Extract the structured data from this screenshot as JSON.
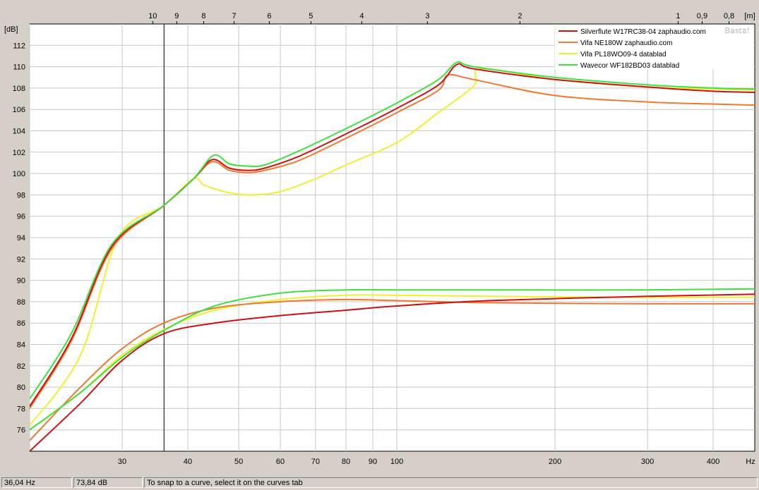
{
  "chart_data": {
    "type": "line",
    "x_axis": {
      "label": "Hz",
      "scale": "log",
      "range": [
        20,
        480
      ],
      "ticks": [
        30,
        40,
        50,
        60,
        70,
        80,
        90,
        100,
        200,
        300,
        400
      ]
    },
    "top_axis": {
      "label": "[m]",
      "ticks": [
        "10",
        "9",
        "8",
        "7",
        "6",
        "5",
        "4",
        "3",
        "2",
        "1",
        "0,9",
        "0,8"
      ]
    },
    "y_axis": {
      "label": "[dB]",
      "range": [
        74,
        114
      ],
      "ticks": [
        76,
        78,
        80,
        82,
        84,
        86,
        88,
        90,
        92,
        94,
        96,
        98,
        100,
        102,
        104,
        106,
        108,
        110,
        112
      ]
    },
    "grid": true,
    "legend_position": "top-right",
    "watermark": "Basta!",
    "cursor_x": 36.04,
    "series": [
      {
        "name": "Silverflute W17RC38-04 zaphaudio.com",
        "color": "#d01010",
        "upper": [
          [
            20,
            78.2
          ],
          [
            24,
            84.5
          ],
          [
            28.7,
            93.2
          ],
          [
            36,
            97
          ],
          [
            41,
            99.5
          ],
          [
            44.5,
            101.3
          ],
          [
            48,
            100.5
          ],
          [
            52,
            100.3
          ],
          [
            56,
            100.5
          ],
          [
            65,
            101.6
          ],
          [
            80,
            103.7
          ],
          [
            100,
            106.1
          ],
          [
            120,
            108.3
          ],
          [
            130,
            110.2
          ],
          [
            140,
            109.8
          ],
          [
            200,
            108.8
          ],
          [
            300,
            108.1
          ],
          [
            400,
            107.7
          ],
          [
            480,
            107.6
          ]
        ],
        "lower": [
          [
            20,
            74
          ],
          [
            25,
            78.5
          ],
          [
            30,
            82.5
          ],
          [
            36,
            85
          ],
          [
            45,
            86
          ],
          [
            60,
            86.7
          ],
          [
            80,
            87.2
          ],
          [
            100,
            87.6
          ],
          [
            150,
            88.1
          ],
          [
            300,
            88.5
          ],
          [
            480,
            88.7
          ]
        ]
      },
      {
        "name": "Vifa NE180W zaphaudio.com",
        "color": "#f07830",
        "upper": [
          [
            20,
            78
          ],
          [
            24,
            84.3
          ],
          [
            28.7,
            93
          ],
          [
            36,
            97
          ],
          [
            41,
            99.5
          ],
          [
            44.5,
            101.1
          ],
          [
            48,
            100.3
          ],
          [
            52,
            100.1
          ],
          [
            56,
            100.3
          ],
          [
            65,
            101.2
          ],
          [
            80,
            103.3
          ],
          [
            100,
            105.7
          ],
          [
            120,
            107.8
          ],
          [
            125,
            109.2
          ],
          [
            140,
            108.8
          ],
          [
            200,
            107.3
          ],
          [
            300,
            106.7
          ],
          [
            400,
            106.5
          ],
          [
            480,
            106.4
          ]
        ],
        "lower": [
          [
            20,
            75
          ],
          [
            25,
            80
          ],
          [
            30,
            83.6
          ],
          [
            36,
            86
          ],
          [
            45,
            87.4
          ],
          [
            60,
            88
          ],
          [
            80,
            88.2
          ],
          [
            100,
            88.1
          ],
          [
            150,
            87.9
          ],
          [
            300,
            87.8
          ],
          [
            480,
            87.8
          ]
        ]
      },
      {
        "name": "Vifa PL18WO09-4 datablad",
        "color": "#f0f030",
        "upper": [
          [
            20,
            76.4
          ],
          [
            25,
            83
          ],
          [
            29.5,
            94
          ],
          [
            36,
            97
          ],
          [
            41,
            99.5
          ],
          [
            43,
            98.9
          ],
          [
            48,
            98.2
          ],
          [
            53,
            98
          ],
          [
            60,
            98.3
          ],
          [
            70,
            99.5
          ],
          [
            80,
            100.8
          ],
          [
            100,
            102.9
          ],
          [
            120,
            105.7
          ],
          [
            140,
            108.2
          ],
          [
            145,
            109.8
          ],
          [
            200,
            108.8
          ],
          [
            300,
            108.1
          ],
          [
            400,
            107.9
          ],
          [
            480,
            107.8
          ]
        ],
        "lower": [
          [
            20,
            76
          ],
          [
            25,
            79.5
          ],
          [
            30,
            83
          ],
          [
            36,
            85.4
          ],
          [
            45,
            87.2
          ],
          [
            60,
            88.2
          ],
          [
            80,
            88.6
          ],
          [
            100,
            88.6
          ],
          [
            150,
            88.5
          ],
          [
            300,
            88.4
          ],
          [
            480,
            88.4
          ]
        ]
      },
      {
        "name": "Wavecor WF182BD03 datablad",
        "color": "#40e040",
        "upper": [
          [
            20,
            78.9
          ],
          [
            24,
            85
          ],
          [
            28.7,
            93.4
          ],
          [
            36,
            97
          ],
          [
            41,
            99.5
          ],
          [
            44.8,
            101.7
          ],
          [
            48,
            100.9
          ],
          [
            52,
            100.7
          ],
          [
            56,
            100.8
          ],
          [
            65,
            102.1
          ],
          [
            80,
            104.2
          ],
          [
            100,
            106.6
          ],
          [
            120,
            108.8
          ],
          [
            130,
            110.4
          ],
          [
            140,
            110
          ],
          [
            200,
            109
          ],
          [
            300,
            108.3
          ],
          [
            400,
            108
          ],
          [
            480,
            107.9
          ]
        ],
        "lower": [
          [
            20,
            76
          ],
          [
            25,
            79.5
          ],
          [
            30,
            82.8
          ],
          [
            36,
            85.3
          ],
          [
            45,
            87.6
          ],
          [
            60,
            88.8
          ],
          [
            80,
            89.1
          ],
          [
            100,
            89.1
          ],
          [
            150,
            89.1
          ],
          [
            300,
            89.1
          ],
          [
            480,
            89.2
          ]
        ]
      }
    ]
  },
  "status": {
    "frequency": "36,04 Hz",
    "level": "73,84 dB",
    "hint": "To snap to a curve, select it on the curves tab"
  }
}
